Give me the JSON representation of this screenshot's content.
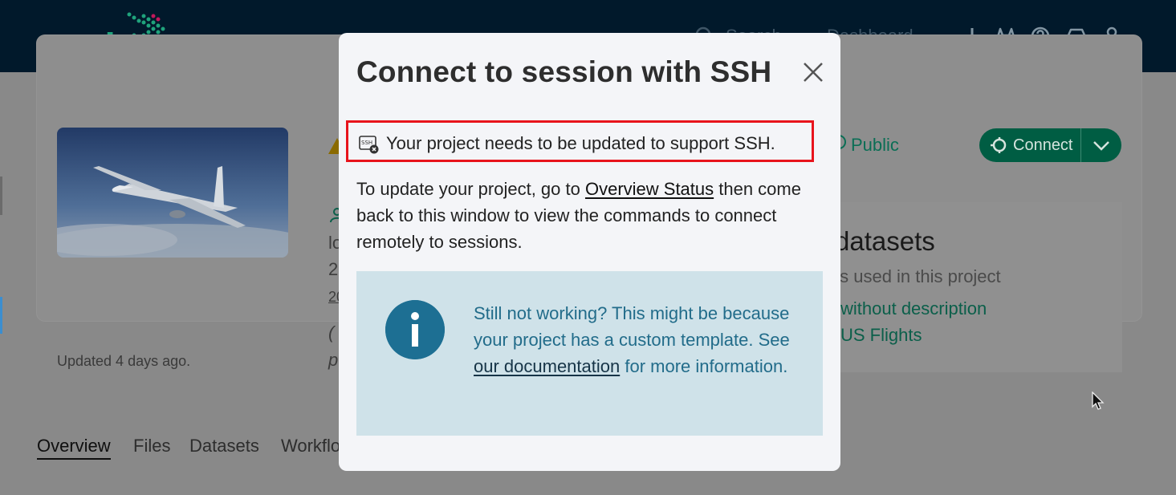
{
  "nav": {
    "logo_text": "renku",
    "search_label": "Search",
    "dashboard_label": "Dashboard",
    "icons": [
      "plus-icon",
      "gitlab-icon",
      "help-icon",
      "inbox-icon",
      "user-icon"
    ]
  },
  "project": {
    "updated": "Updated 4 days ago.",
    "visibility": "Public",
    "connect_label": "Connect",
    "side_fragments": [
      "lo",
      "2",
      "20",
      "(",
      "p"
    ]
  },
  "datasets": {
    "title": "datasets",
    "subtitle": "ts used in this project",
    "items": [
      "without description",
      "US Flights"
    ]
  },
  "tabs": [
    "Overview",
    "Files",
    "Datasets",
    "Workflo"
  ],
  "modal": {
    "title": "Connect to session with SSH",
    "alert": "Your project needs to be updated to support SSH.",
    "body_before": "To update your project, go to ",
    "body_link": "Overview Status",
    "body_after": " then come back to this window to view the commands to connect remotely to sessions.",
    "info_before": "Still not working? This might be because your project has a custom template. See ",
    "info_link": "our documentation",
    "info_after": " for more information."
  },
  "colors": {
    "brand": "#1fa37c",
    "alert_border": "#e8141c",
    "info_bg": "#cfe2e9",
    "info_text": "#226c8a",
    "connect_bg": "#005d43"
  }
}
